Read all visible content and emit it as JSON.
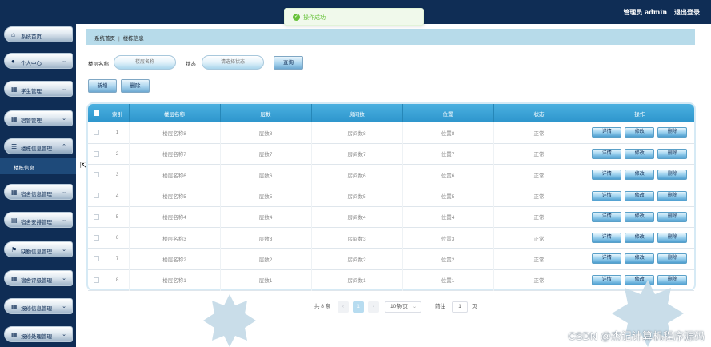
{
  "header": {
    "user_label": "管理员 admin",
    "logout_label": "退出登录"
  },
  "toast": {
    "message": "操作成功"
  },
  "sidebar": {
    "items": [
      {
        "label": "系统首页",
        "icon": "home-icon"
      },
      {
        "label": "个人中心",
        "icon": "user-icon"
      },
      {
        "label": "学生管理",
        "icon": "grid-icon"
      },
      {
        "label": "宿管管理",
        "icon": "grid-icon"
      },
      {
        "label": "楼栋信息管理",
        "icon": "list-icon"
      },
      {
        "label": "宿舍信息管理",
        "icon": "grid-icon"
      },
      {
        "label": "宿舍安排管理",
        "icon": "doc-icon"
      },
      {
        "label": "缺勤信息管理",
        "icon": "flag-icon"
      },
      {
        "label": "宿舍评级管理",
        "icon": "grid-icon"
      },
      {
        "label": "报修信息管理",
        "icon": "grid-icon"
      },
      {
        "label": "报修处理管理",
        "icon": "grid-icon"
      }
    ],
    "active_sub": "楼栋信息"
  },
  "breadcrumb": {
    "home": "系统首页",
    "current": "楼栋信息"
  },
  "search": {
    "name_label": "楼层名称",
    "name_placeholder": "楼层名称",
    "status_label": "状态",
    "status_placeholder": "请选择状态",
    "query_button": "查询"
  },
  "actions": {
    "add": "新增",
    "delete": "删除"
  },
  "table": {
    "columns": [
      "索引",
      "楼层名称",
      "层数",
      "房间数",
      "位置",
      "状态",
      "操作"
    ],
    "rows": [
      {
        "index": "1",
        "name": "楼层名称8",
        "floors": "层数8",
        "rooms": "房间数8",
        "location": "位置8",
        "status": "正常"
      },
      {
        "index": "2",
        "name": "楼层名称7",
        "floors": "层数7",
        "rooms": "房间数7",
        "location": "位置7",
        "status": "正常"
      },
      {
        "index": "3",
        "name": "楼层名称6",
        "floors": "层数6",
        "rooms": "房间数6",
        "location": "位置6",
        "status": "正常"
      },
      {
        "index": "4",
        "name": "楼层名称5",
        "floors": "层数5",
        "rooms": "房间数5",
        "location": "位置5",
        "status": "正常"
      },
      {
        "index": "5",
        "name": "楼层名称4",
        "floors": "层数4",
        "rooms": "房间数4",
        "location": "位置4",
        "status": "正常"
      },
      {
        "index": "6",
        "name": "楼层名称3",
        "floors": "层数3",
        "rooms": "房间数3",
        "location": "位置3",
        "status": "正常"
      },
      {
        "index": "7",
        "name": "楼层名称2",
        "floors": "层数2",
        "rooms": "房间数2",
        "location": "位置2",
        "status": "正常"
      },
      {
        "index": "8",
        "name": "楼层名称1",
        "floors": "层数1",
        "rooms": "房间数1",
        "location": "位置1",
        "status": "正常"
      }
    ],
    "row_actions": [
      "详情",
      "修改",
      "删除"
    ]
  },
  "pagination": {
    "total_label": "共 8 条",
    "prev": "‹",
    "current_page": "1",
    "next": "›",
    "page_size": "10条/页",
    "jump_label": "前往",
    "jump_value": "1",
    "page_suffix": "页"
  },
  "watermark": "CSDN @杰记计算机程序源码",
  "colors": {
    "sidebar_bg": "#0f2d55",
    "header_blue": "#2d95cc",
    "breadcrumb_bg": "#b7dbea",
    "success": "#67c23a"
  }
}
